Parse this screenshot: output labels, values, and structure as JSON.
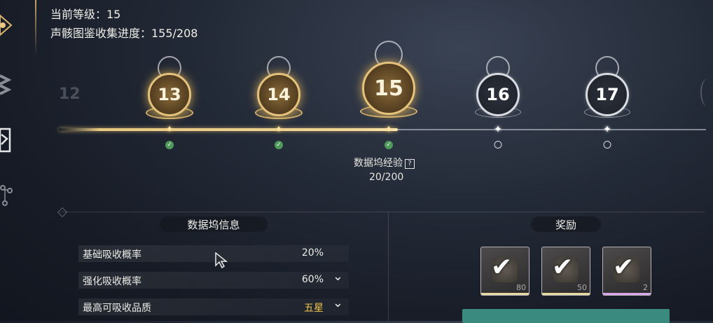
{
  "header": {
    "level_label": "当前等级：15",
    "collection_label": "声骸图鉴收集进度：155/208"
  },
  "levels": [
    {
      "num": "13",
      "state": "gold",
      "done": true
    },
    {
      "num": "14",
      "state": "gold",
      "done": true
    },
    {
      "num": "15",
      "state": "gold-current",
      "done": true
    },
    {
      "num": "16",
      "state": "grey",
      "done": false
    },
    {
      "num": "17",
      "state": "grey",
      "done": false
    }
  ],
  "side_left": "12",
  "exp": {
    "title": "数据坞经验",
    "help": "?",
    "value": "20/200",
    "progress": 0.1
  },
  "info": {
    "title": "数据坞信息",
    "rows": [
      {
        "label": "基础吸收概率",
        "value": "20%",
        "expandable": false
      },
      {
        "label": "强化吸收概率",
        "value": "60%",
        "expandable": true
      },
      {
        "label": "最高可吸收品质",
        "value": "五星",
        "expandable": true
      }
    ]
  },
  "rewards": {
    "title": "奖励",
    "items": [
      {
        "count": "80",
        "claimed": true,
        "rarity_color": "#e8d9a0"
      },
      {
        "count": "50",
        "claimed": true,
        "rarity_color": "#e8d9a0"
      },
      {
        "count": "2",
        "claimed": true,
        "rarity_color": "#d6a6e8"
      }
    ]
  },
  "colors": {
    "gold": "#e6c37c",
    "accent_button": "#3a8a80",
    "quality_gold": "#f2c94c"
  }
}
